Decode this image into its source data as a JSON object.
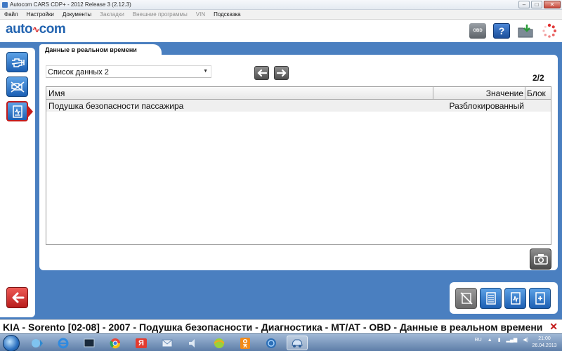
{
  "window": {
    "title": "Autocom CARS CDP+ - 2012 Release 3 (2.12.3)",
    "minimize_glyph": "–",
    "maximize_glyph": "□",
    "close_glyph": "✕"
  },
  "menu": {
    "items": [
      {
        "label": "Файл",
        "enabled": true
      },
      {
        "label": "Настройки",
        "enabled": true
      },
      {
        "label": "Документы",
        "enabled": true
      },
      {
        "label": "Закладки",
        "enabled": false
      },
      {
        "label": "Внешние программы",
        "enabled": false
      },
      {
        "label": "VIN",
        "enabled": false
      },
      {
        "label": "Подсказка",
        "enabled": true
      }
    ]
  },
  "logo": {
    "left": "auto",
    "right": "com"
  },
  "toolbar": {
    "obd_label": "OBD",
    "help_label": "?"
  },
  "tab": {
    "title": "Данные в реальном времени"
  },
  "data_list": {
    "selected": "Список данных 2"
  },
  "pagination": {
    "text": "2/2"
  },
  "table": {
    "columns": {
      "name": "Имя",
      "value": "Значение",
      "block": "Блок"
    },
    "rows": [
      {
        "name": "Подушка безопасности пассажира",
        "value": "Разблокированный",
        "block": ""
      }
    ]
  },
  "status": {
    "text": "KIA - Sorento [02-08] - 2007 - Подушка безопасности - Диагностика - MT/AT - OBD - Данные в реальном времени",
    "close_glyph": "✕"
  },
  "taskbar": {
    "language": "RU",
    "time": "21:00",
    "date": "26.04.2013",
    "icons": [
      "media-icon",
      "ie-icon",
      "terminal-icon",
      "chrome-icon",
      "yandex-icon",
      "mail-icon",
      "speaker-icon",
      "ball-icon",
      "odnoklassniki-icon",
      "network-icon",
      "car-icon"
    ],
    "yandex_letter": "Я"
  },
  "colors": {
    "accent_blue": "#4a7fc0",
    "button_blue": "#1c5fb3",
    "back_red": "#c31b1b",
    "logo_blue": "#2364b0"
  }
}
